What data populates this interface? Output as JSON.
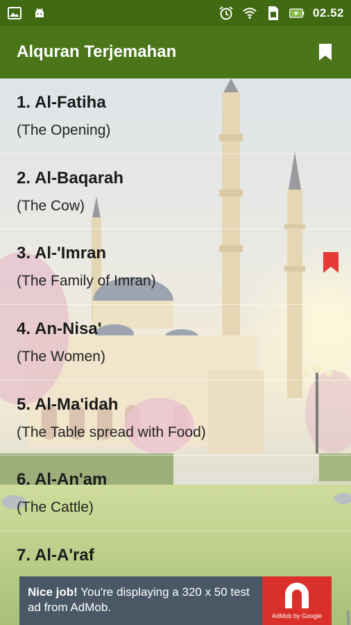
{
  "status_bar": {
    "icons": [
      "image-icon",
      "android-icon",
      "alarm-icon",
      "wifi-icon",
      "sim-card-icon",
      "battery-charging-icon"
    ],
    "time": "02.52"
  },
  "toolbar": {
    "title": "Alquran Terjemahan",
    "bookmark_icon": "bookmark-icon"
  },
  "colors": {
    "status_bar": "#3f6a12",
    "toolbar": "#4a7518",
    "bookmark_red": "#e53935",
    "ad_background": "#4a5866",
    "ad_logo": "#d9302b"
  },
  "surahs": [
    {
      "number": "1.",
      "name": "Al-Fatiha",
      "meaning": "(The Opening)",
      "bookmarked": false
    },
    {
      "number": "2.",
      "name": "Al-Baqarah",
      "meaning": "(The Cow)",
      "bookmarked": false
    },
    {
      "number": "3.",
      "name": "Al-'Imran",
      "meaning": "(The Family of Imran)",
      "bookmarked": true
    },
    {
      "number": "4.",
      "name": "An-Nisa'",
      "meaning": "(The Women)",
      "bookmarked": false
    },
    {
      "number": "5.",
      "name": "Al-Ma'idah",
      "meaning": "(The Table spread with Food)",
      "bookmarked": false
    },
    {
      "number": "6.",
      "name": "Al-An'am",
      "meaning": "(The Cattle)",
      "bookmarked": false
    },
    {
      "number": "7.",
      "name": "Al-A'raf",
      "meaning": "",
      "bookmarked": false
    }
  ],
  "ad": {
    "bold": "Nice job!",
    "text": " You're displaying a 320 x 50 test ad from AdMob.",
    "logo_caption": "AdMob by Google"
  }
}
